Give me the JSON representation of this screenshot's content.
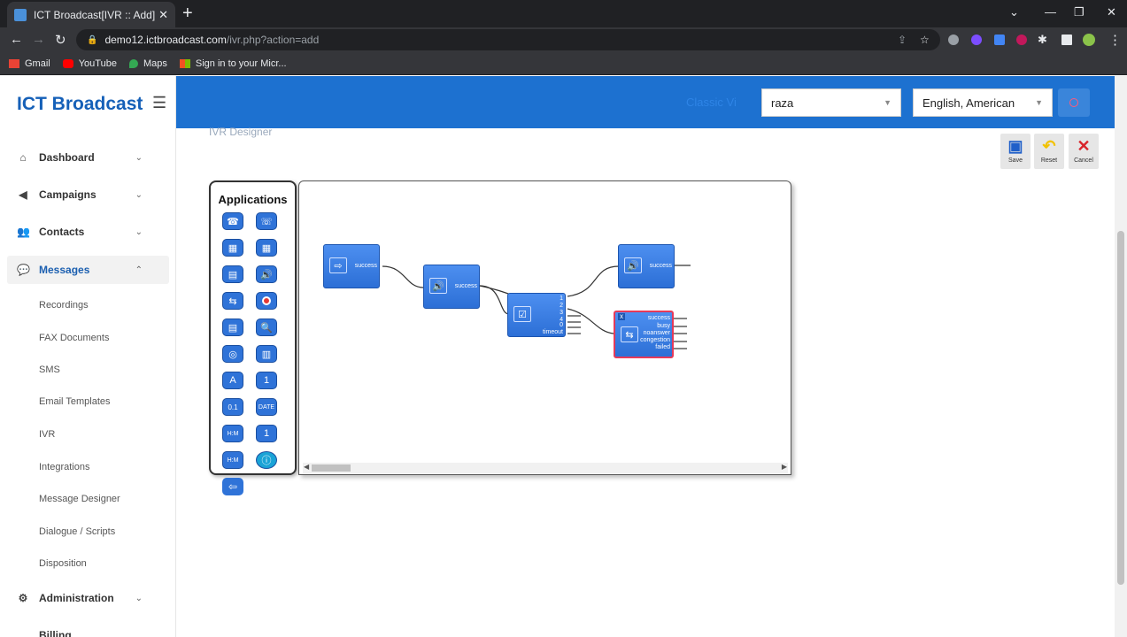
{
  "browser": {
    "tab_title": "ICT Broadcast[IVR :: Add]",
    "url_host": "demo12.ictbroadcast.com",
    "url_path": "/ivr.php?action=add",
    "bookmarks": [
      {
        "label": "Gmail",
        "icon": "gmail-icon",
        "color": "#ea4335"
      },
      {
        "label": "YouTube",
        "icon": "youtube-icon",
        "color": "#ff0000"
      },
      {
        "label": "Maps",
        "icon": "maps-icon",
        "color": "#34a853"
      },
      {
        "label": "Sign in to your Micr...",
        "icon": "microsoft-icon",
        "color": "#f25022"
      }
    ]
  },
  "sidebar": {
    "brand": "ICT Broadcast",
    "items": [
      {
        "label": "Dashboard",
        "icon": "dashboard-icon"
      },
      {
        "label": "Campaigns",
        "icon": "megaphone-icon"
      },
      {
        "label": "Contacts",
        "icon": "users-icon"
      },
      {
        "label": "Messages",
        "icon": "messages-icon"
      },
      {
        "label": "Administration",
        "icon": "gears-icon"
      },
      {
        "label": "Billing",
        "icon": "billing-icon"
      }
    ],
    "sub_items": [
      "Recordings",
      "FAX Documents",
      "SMS",
      "Email Templates",
      "IVR",
      "Integrations",
      "Message Designer",
      "Dialogue / Scripts",
      "Disposition"
    ]
  },
  "header": {
    "ghost_text": "Classic Vi",
    "user_select": "raza",
    "language_select": "English, American"
  },
  "page": {
    "heading": "IVR Designer",
    "toolbar": {
      "save": "Save",
      "reset": "Reset",
      "cancel": "Cancel"
    }
  },
  "designer": {
    "apps_title": "Applications",
    "nodes": {
      "start": {
        "ports": [
          "success"
        ]
      },
      "play": {
        "ports": [
          "success"
        ]
      },
      "menu": {
        "ports": [
          "1",
          "2",
          "3",
          "4",
          "0",
          "timeout"
        ]
      },
      "play2": {
        "ports": [
          "success"
        ]
      },
      "transfer": {
        "close": "x",
        "ports": [
          "success",
          "busy",
          "noanswer",
          "congestion",
          "failed"
        ]
      }
    }
  },
  "colors": {
    "header_blue": "#1d71d0",
    "brand_blue": "#1560b8",
    "node_blue": "#2c6fd6",
    "selected_border": "#e53a5a",
    "port_green": "#5fd35f"
  }
}
